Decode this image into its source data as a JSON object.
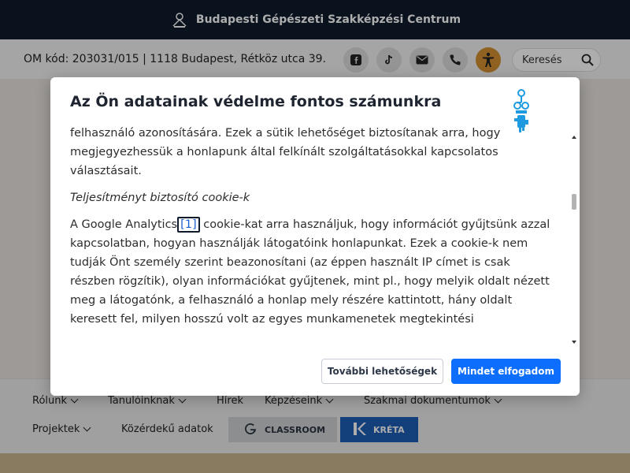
{
  "header": {
    "site_title": "Budapesti Gépészeti Szakképzési Centrum"
  },
  "infobar": {
    "address": "OM kód: 203031/015 | 1118 Budapest, Rétköz utca 39.",
    "search_placeholder": "Keresés",
    "social_icons": [
      "facebook-icon",
      "tiktok-icon",
      "mail-icon",
      "phone-icon",
      "accessibility-icon"
    ],
    "accessibility_color": "#d59133"
  },
  "nav": {
    "items": [
      {
        "label": "Rólunk",
        "has_dropdown": true
      },
      {
        "label": "Tanulóinknak",
        "has_dropdown": true
      },
      {
        "label": "Hírek",
        "has_dropdown": false
      },
      {
        "label": "Képzéseink",
        "has_dropdown": true
      },
      {
        "label": "Szakmai dokumentumok",
        "has_dropdown": true
      },
      {
        "label": "Projektek",
        "has_dropdown": true
      },
      {
        "label": "Közérdekű adatok",
        "has_dropdown": false
      }
    ],
    "classroom_label": "CLASSROOM",
    "kreta_label": "KRÉTA",
    "kreta_color": "#1d5fb6"
  },
  "modal": {
    "title": "Az Ön adatainak védelme fontos számunkra",
    "paragraphs": {
      "p1": "felhasználó azonosítására. Ezek a sütik lehetőséget biztosítanak arra, hogy megjegyezhessük a honlapunk által felkínált szolgáltatásokkal kapcsolatos választásait.",
      "p2": "Teljesítményt biztosító cookie-k",
      "p3_before": "A Google Analytics",
      "p3_ref": "[1]",
      "p3_after": " cookie-kat arra használjuk, hogy információt gyűjtsünk azzal kapcsolatban, hogyan használják látogatóink honlapunkat. Ezek a cookie-k nem tudják Önt személy szerint beazonosítani (az éppen használt IP címet is csak részben rögzítik), olyan információkat gyűjtenek, mint pl., hogy melyik oldalt nézett meg a látogatónk, a felhasználó a honlap mely részére kattintott, hány oldalt keresett fel, milyen hosszú volt az egyes munkamenetek megtekintési"
    },
    "buttons": {
      "more": "További lehetőségek",
      "accept": "Mindet elfogadom"
    },
    "accent_color": "#0d6efd"
  }
}
